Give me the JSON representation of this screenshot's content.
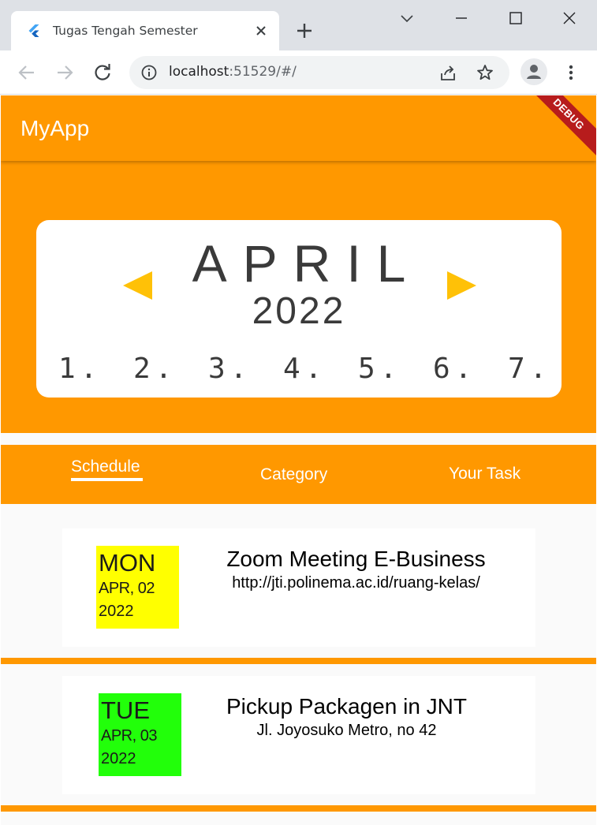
{
  "browser": {
    "tab_title": "Tugas Tengah Semester",
    "url_host": "localhost",
    "url_path": ":51529/#/"
  },
  "app": {
    "title": "MyApp",
    "debug_label": "DEBUG",
    "calendar": {
      "month": "APRIL",
      "year": "2022",
      "days": [
        "1.",
        "2.",
        "3.",
        "4.",
        "5.",
        "6.",
        "7."
      ]
    },
    "tabs": [
      {
        "label": "Schedule",
        "selected": true
      },
      {
        "label": "Category",
        "selected": false
      },
      {
        "label": "Your Task",
        "selected": false
      }
    ],
    "tasks": [
      {
        "dow": "MON",
        "month_day": "APR, 02",
        "year": "2022",
        "title": "Zoom Meeting E-Business",
        "detail": "http://jti.polinema.ac.id/ruang-kelas/",
        "color": "#ffff00"
      },
      {
        "dow": "TUE",
        "month_day": "APR, 03",
        "year": "2022",
        "title": "Pickup Packagen in JNT",
        "detail": "Jl. Joyosuko Metro, no 42",
        "color": "#22ff0a"
      }
    ]
  },
  "colors": {
    "primary": "#ff9800",
    "arrow": "#ffc107",
    "debug": "#b71c1c"
  },
  "icons": [
    "flutter-icon",
    "close-icon",
    "plus-icon",
    "chevron-down-icon",
    "minimize-icon",
    "maximize-icon",
    "window-close-icon",
    "back-icon",
    "forward-icon",
    "reload-icon",
    "info-icon",
    "share-icon",
    "star-icon",
    "profile-icon",
    "kebab-menu-icon"
  ]
}
